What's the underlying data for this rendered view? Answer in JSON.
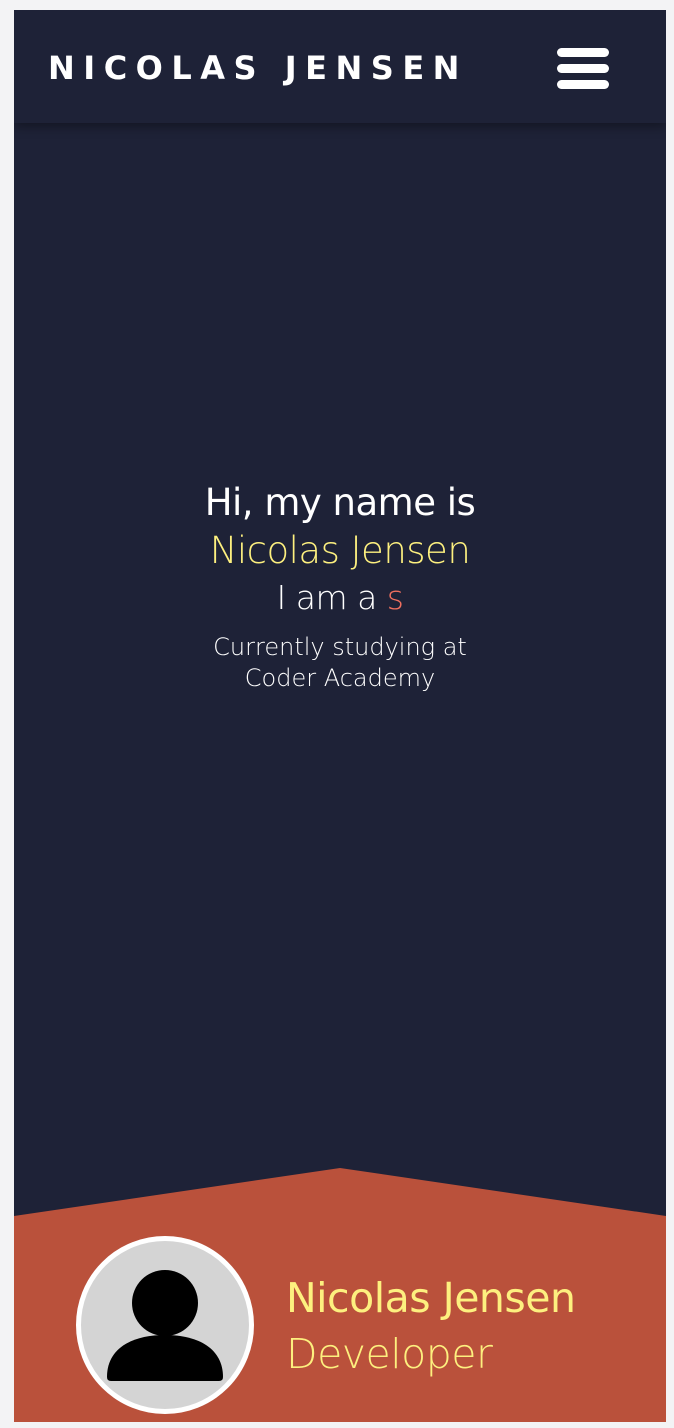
{
  "navbar": {
    "brand": "NICOLAS JENSEN",
    "menu_icon": "hamburger-menu-icon"
  },
  "hero": {
    "greeting": "Hi, my name is",
    "name": "Nicolas Jensen",
    "role_prefix": "I am a ",
    "role_typed": "s",
    "study_line1": "Currently studying at",
    "study_line2": "Coder Academy"
  },
  "profile": {
    "avatar_icon": "user-avatar-icon",
    "name": "Nicolas Jensen",
    "role": "Developer"
  },
  "colors": {
    "background": "#1e2237",
    "accent_yellow": "#fdf07f",
    "accent_coral": "#ef6f5f",
    "footer": "#ba513b"
  }
}
